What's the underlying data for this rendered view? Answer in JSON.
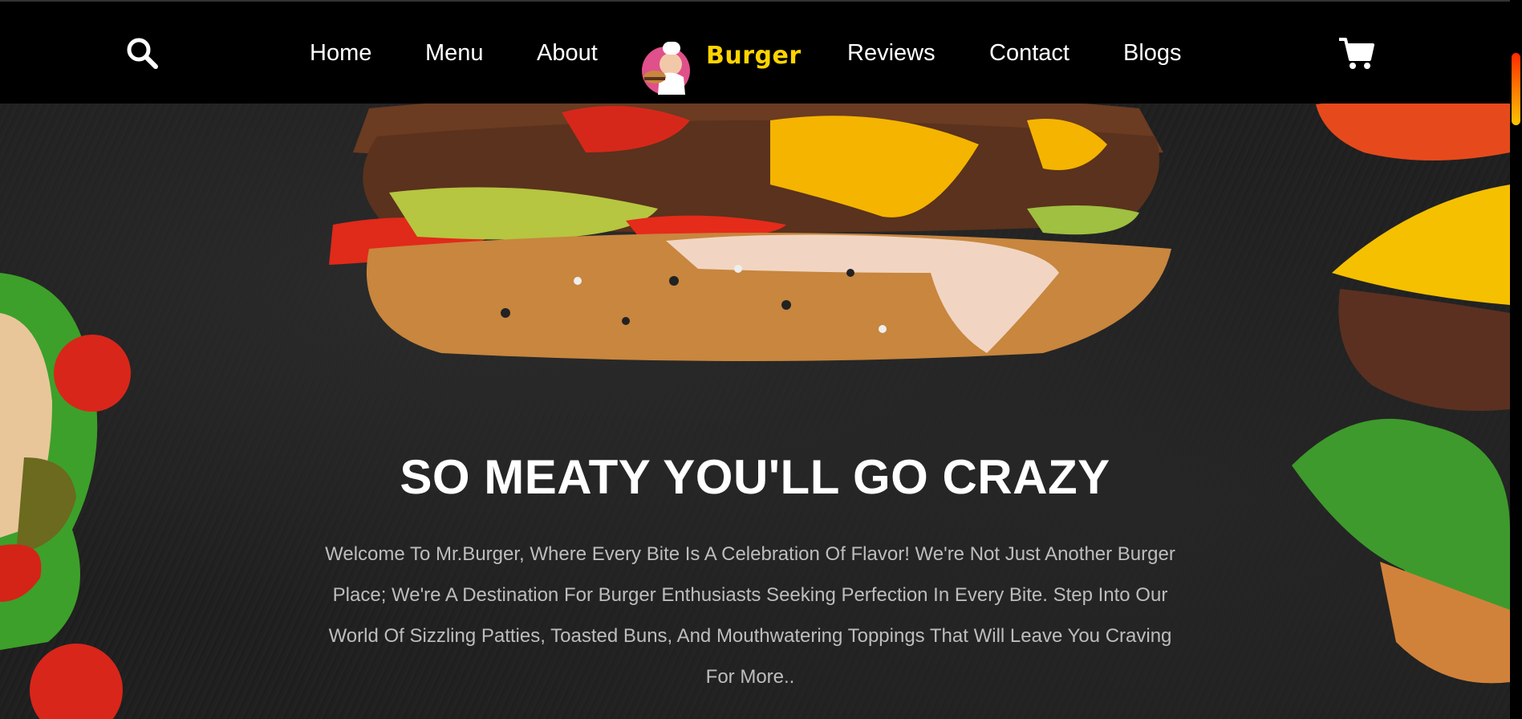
{
  "nav": {
    "links": [
      {
        "label": "Home"
      },
      {
        "label": "Menu"
      },
      {
        "label": "About"
      },
      {
        "label": "Reviews"
      },
      {
        "label": "Contact"
      },
      {
        "label": "Blogs"
      }
    ],
    "logo_text": "Burger",
    "icons": {
      "search": "search-icon",
      "cart": "cart-icon"
    }
  },
  "hero": {
    "title": "SO MEATY YOU'LL GO CRAZY",
    "description": "Welcome To Mr.Burger, Where Every Bite Is A Celebration Of Flavor! We're Not Just Another Burger Place; We're A Destination For Burger Enthusiasts Seeking Perfection In Every Bite. Step Into Our World Of Sizzling Patties, Toasted Buns, And Mouthwatering Toppings That Will Leave You Craving For More.."
  },
  "colors": {
    "navbar_bg": "#000000",
    "brand_yellow": "#ffd400",
    "scroll_gradient_top": "#ff2a00",
    "scroll_gradient_bottom": "#ffc400"
  }
}
